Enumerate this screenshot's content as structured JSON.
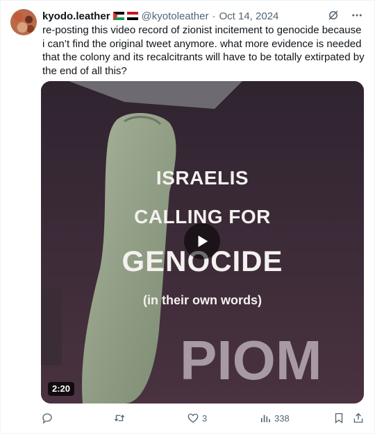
{
  "tweet": {
    "display_name": "kyodo.leather",
    "handle": "@kyotoleather",
    "separator": "·",
    "date": "Oct 14, 2024",
    "text": "re-posting this video record of zionist incitement to genocide because i can’t find the original tweet anymore. what more evidence is needed that the colony and its recalcitrants will have to be totally extirpated by the end of all this?"
  },
  "media": {
    "overlay_line1": "ISRAELIS",
    "overlay_line2": "CALLING FOR",
    "overlay_line3": "GENOCIDE",
    "overlay_line4": "(in their own words)",
    "background_text": "PIOM",
    "duration": "2:20"
  },
  "actions": {
    "reply_count": "",
    "repost_count": "",
    "like_count": "3",
    "view_count": "338"
  },
  "icons": [
    "grok-icon",
    "more-icon",
    "play-icon",
    "reply-icon",
    "repost-icon",
    "like-icon",
    "views-icon",
    "bookmark-icon",
    "share-icon"
  ],
  "colors": {
    "text": "#0f1419",
    "secondary": "#536471"
  }
}
